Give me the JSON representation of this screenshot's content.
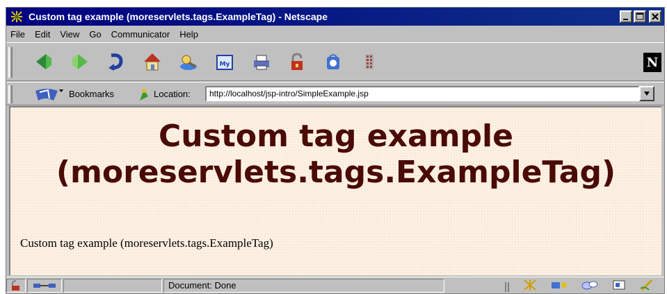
{
  "window": {
    "title": "Custom tag example (moreservlets.tags.ExampleTag) - Netscape"
  },
  "menu": {
    "items": [
      "File",
      "Edit",
      "View",
      "Go",
      "Communicator",
      "Help"
    ]
  },
  "toolbar": {
    "icons": [
      "back-icon",
      "forward-icon",
      "reload-icon",
      "home-icon",
      "search-icon",
      "my-netscape-icon",
      "print-icon",
      "security-icon",
      "shop-icon",
      "stop-icon"
    ]
  },
  "location_bar": {
    "bookmarks_label": "Bookmarks",
    "location_label": "Location:",
    "url": "http://localhost/jsp-intro/SimpleExample.jsp"
  },
  "page": {
    "heading_line1": "Custom tag example",
    "heading_line2": "(moreservlets.tags.ExampleTag)",
    "body_text": "Custom tag example (moreservlets.tags.ExampleTag)"
  },
  "status": {
    "text": "Document: Done"
  },
  "colors": {
    "titlebar": "#000080",
    "heading": "#4a0a05",
    "page_background": "#fdf1e4"
  }
}
